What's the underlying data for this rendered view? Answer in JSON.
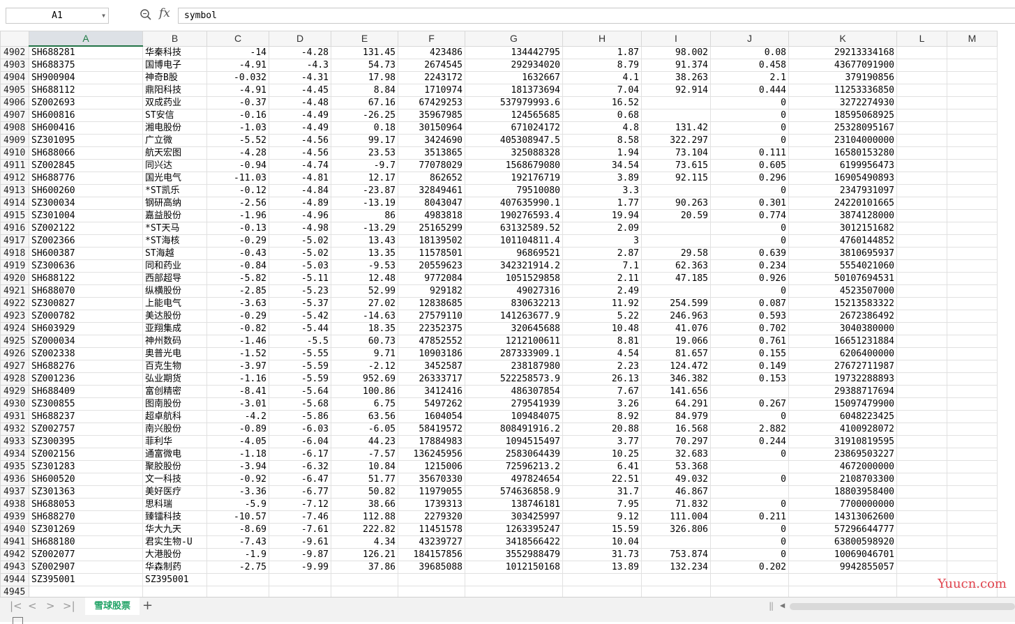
{
  "formula_bar": {
    "cell_ref": "A1",
    "fx_label": "fx",
    "formula_value": "symbol"
  },
  "columns": [
    "A",
    "B",
    "C",
    "D",
    "E",
    "F",
    "G",
    "H",
    "I",
    "J",
    "K",
    "L",
    "M"
  ],
  "active_column": "A",
  "rows": [
    {
      "r": "4902",
      "c": [
        "SH688281",
        "华秦科技",
        "-14",
        "-4.28",
        "131.45",
        "423486",
        "134442795",
        "1.87",
        "98.002",
        "0.08",
        "29213334168"
      ]
    },
    {
      "r": "4903",
      "c": [
        "SH688375",
        "国博电子",
        "-4.91",
        "-4.3",
        "54.73",
        "2674545",
        "292934020",
        "8.79",
        "91.374",
        "0.458",
        "43677091900"
      ]
    },
    {
      "r": "4904",
      "c": [
        "SH900904",
        "神奇B股",
        "-0.032",
        "-4.31",
        "17.98",
        "2243172",
        "1632667",
        "4.1",
        "38.263",
        "2.1",
        "379190856"
      ]
    },
    {
      "r": "4905",
      "c": [
        "SH688112",
        "鼎阳科技",
        "-4.91",
        "-4.45",
        "8.84",
        "1710974",
        "181373694",
        "7.04",
        "92.914",
        "0.444",
        "11253336850"
      ]
    },
    {
      "r": "4906",
      "c": [
        "SZ002693",
        "双成药业",
        "-0.37",
        "-4.48",
        "67.16",
        "67429253",
        "537979993.6",
        "16.52",
        "",
        "0",
        "3272274930"
      ]
    },
    {
      "r": "4907",
      "c": [
        "SH600816",
        "ST安信",
        "-0.16",
        "-4.49",
        "-26.25",
        "35967985",
        "124565685",
        "0.68",
        "",
        "0",
        "18595068925"
      ]
    },
    {
      "r": "4908",
      "c": [
        "SH600416",
        "湘电股份",
        "-1.03",
        "-4.49",
        "0.18",
        "30150964",
        "671024172",
        "4.8",
        "131.42",
        "0",
        "25328095167"
      ]
    },
    {
      "r": "4909",
      "c": [
        "SZ301095",
        "广立微",
        "-5.52",
        "-4.56",
        "99.17",
        "3424690",
        "405308947.5",
        "8.58",
        "322.297",
        "0",
        "23104000000"
      ]
    },
    {
      "r": "4910",
      "c": [
        "SH688066",
        "航天宏图",
        "-4.28",
        "-4.56",
        "23.53",
        "3513865",
        "325088328",
        "1.94",
        "73.104",
        "0.111",
        "16580153280"
      ]
    },
    {
      "r": "4911",
      "c": [
        "SZ002845",
        "同兴达",
        "-0.94",
        "-4.74",
        "-9.7",
        "77078029",
        "1568679080",
        "34.54",
        "73.615",
        "0.605",
        "6199956473"
      ]
    },
    {
      "r": "4912",
      "c": [
        "SH688776",
        "国光电气",
        "-11.03",
        "-4.81",
        "12.17",
        "862652",
        "192176719",
        "3.89",
        "92.115",
        "0.296",
        "16905490893"
      ]
    },
    {
      "r": "4913",
      "c": [
        "SH600260",
        "*ST凯乐",
        "-0.12",
        "-4.84",
        "-23.87",
        "32849461",
        "79510080",
        "3.3",
        "",
        "0",
        "2347931097"
      ]
    },
    {
      "r": "4914",
      "c": [
        "SZ300034",
        "钢研高纳",
        "-2.56",
        "-4.89",
        "-13.19",
        "8043047",
        "407635990.1",
        "1.77",
        "90.263",
        "0.301",
        "24220101665"
      ]
    },
    {
      "r": "4915",
      "c": [
        "SZ301004",
        "嘉益股份",
        "-1.96",
        "-4.96",
        "86",
        "4983818",
        "190276593.4",
        "19.94",
        "20.59",
        "0.774",
        "3874128000"
      ]
    },
    {
      "r": "4916",
      "c": [
        "SZ002122",
        "*ST天马",
        "-0.13",
        "-4.98",
        "-13.29",
        "25165299",
        "63132589.52",
        "2.09",
        "",
        "0",
        "3012151682"
      ]
    },
    {
      "r": "4917",
      "c": [
        "SZ002366",
        "*ST海核",
        "-0.29",
        "-5.02",
        "13.43",
        "18139502",
        "101104811.4",
        "3",
        "",
        "0",
        "4760144852"
      ]
    },
    {
      "r": "4918",
      "c": [
        "SH600387",
        "ST海越",
        "-0.43",
        "-5.02",
        "13.35",
        "11578501",
        "96869521",
        "2.87",
        "29.58",
        "0.639",
        "3810695937"
      ]
    },
    {
      "r": "4919",
      "c": [
        "SZ300636",
        "同和药业",
        "-0.84",
        "-5.03",
        "-9.53",
        "20559623",
        "342321914.2",
        "7.1",
        "62.363",
        "0.234",
        "5554021060"
      ]
    },
    {
      "r": "4920",
      "c": [
        "SH688122",
        "西部超导",
        "-5.82",
        "-5.11",
        "12.48",
        "9772084",
        "1051529858",
        "2.11",
        "47.185",
        "0.926",
        "50107694531"
      ]
    },
    {
      "r": "4921",
      "c": [
        "SH688070",
        "纵横股份",
        "-2.85",
        "-5.23",
        "52.99",
        "929182",
        "49027316",
        "2.49",
        "",
        "0",
        "4523507000"
      ]
    },
    {
      "r": "4922",
      "c": [
        "SZ300827",
        "上能电气",
        "-3.63",
        "-5.37",
        "27.02",
        "12838685",
        "830632213",
        "11.92",
        "254.599",
        "0.087",
        "15213583322"
      ]
    },
    {
      "r": "4923",
      "c": [
        "SZ000782",
        "美达股份",
        "-0.29",
        "-5.42",
        "-14.63",
        "27579110",
        "141263677.9",
        "5.22",
        "246.963",
        "0.593",
        "2672386492"
      ]
    },
    {
      "r": "4924",
      "c": [
        "SH603929",
        "亚翔集成",
        "-0.82",
        "-5.44",
        "18.35",
        "22352375",
        "320645688",
        "10.48",
        "41.076",
        "0.702",
        "3040380000"
      ]
    },
    {
      "r": "4925",
      "c": [
        "SZ000034",
        "神州数码",
        "-1.46",
        "-5.5",
        "60.73",
        "47852552",
        "1212100611",
        "8.81",
        "19.066",
        "0.761",
        "16651231884"
      ]
    },
    {
      "r": "4926",
      "c": [
        "SZ002338",
        "奥普光电",
        "-1.52",
        "-5.55",
        "9.71",
        "10903186",
        "287333909.1",
        "4.54",
        "81.657",
        "0.155",
        "6206400000"
      ]
    },
    {
      "r": "4927",
      "c": [
        "SH688276",
        "百克生物",
        "-3.97",
        "-5.59",
        "-2.12",
        "3452587",
        "238187980",
        "2.23",
        "124.472",
        "0.149",
        "27672711987"
      ]
    },
    {
      "r": "4928",
      "c": [
        "SZ001236",
        "弘业期货",
        "-1.16",
        "-5.59",
        "952.69",
        "26333717",
        "522258573.9",
        "26.13",
        "346.382",
        "0.153",
        "19732288893"
      ]
    },
    {
      "r": "4929",
      "c": [
        "SH688409",
        "富创精密",
        "-8.41",
        "-5.64",
        "100.86",
        "3412416",
        "486307854",
        "7.67",
        "141.656",
        "",
        "29388717694"
      ]
    },
    {
      "r": "4930",
      "c": [
        "SZ300855",
        "图南股份",
        "-3.01",
        "-5.68",
        "6.75",
        "5497262",
        "279541939",
        "3.26",
        "64.291",
        "0.267",
        "15097479900"
      ]
    },
    {
      "r": "4931",
      "c": [
        "SH688237",
        "超卓航科",
        "-4.2",
        "-5.86",
        "63.56",
        "1604054",
        "109484075",
        "8.92",
        "84.979",
        "0",
        "6048223425"
      ]
    },
    {
      "r": "4932",
      "c": [
        "SZ002757",
        "南兴股份",
        "-0.89",
        "-6.03",
        "-6.05",
        "58419572",
        "808491916.2",
        "20.88",
        "16.568",
        "2.882",
        "4100928072"
      ]
    },
    {
      "r": "4933",
      "c": [
        "SZ300395",
        "菲利华",
        "-4.05",
        "-6.04",
        "44.23",
        "17884983",
        "1094515497",
        "3.77",
        "70.297",
        "0.244",
        "31910819595"
      ]
    },
    {
      "r": "4934",
      "c": [
        "SZ002156",
        "通富微电",
        "-1.18",
        "-6.17",
        "-7.57",
        "136245956",
        "2583064439",
        "10.25",
        "32.683",
        "0",
        "23869503227"
      ]
    },
    {
      "r": "4935",
      "c": [
        "SZ301283",
        "聚胶股份",
        "-3.94",
        "-6.32",
        "10.84",
        "1215006",
        "72596213.2",
        "6.41",
        "53.368",
        "",
        "4672000000"
      ]
    },
    {
      "r": "4936",
      "c": [
        "SH600520",
        "文一科技",
        "-0.92",
        "-6.47",
        "51.77",
        "35670330",
        "497824654",
        "22.51",
        "49.032",
        "0",
        "2108703300"
      ]
    },
    {
      "r": "4937",
      "c": [
        "SZ301363",
        "美好医疗",
        "-3.36",
        "-6.77",
        "50.82",
        "11979055",
        "574636858.9",
        "31.7",
        "46.867",
        "",
        "18803958400"
      ]
    },
    {
      "r": "4938",
      "c": [
        "SH688053",
        "思科瑞",
        "-5.9",
        "-7.12",
        "38.66",
        "1739313",
        "138746181",
        "7.95",
        "71.832",
        "0",
        "7700000000"
      ]
    },
    {
      "r": "4939",
      "c": [
        "SH688270",
        "臻镭科技",
        "-10.57",
        "-7.46",
        "112.88",
        "2279320",
        "303425997",
        "9.12",
        "111.004",
        "0.211",
        "14313062600"
      ]
    },
    {
      "r": "4940",
      "c": [
        "SZ301269",
        "华大九天",
        "-8.69",
        "-7.61",
        "222.82",
        "11451578",
        "1263395247",
        "15.59",
        "326.806",
        "0",
        "57296644777"
      ]
    },
    {
      "r": "4941",
      "c": [
        "SH688180",
        "君实生物-U",
        "-7.43",
        "-9.61",
        "4.34",
        "43239727",
        "3418566422",
        "10.04",
        "",
        "0",
        "63800598920"
      ]
    },
    {
      "r": "4942",
      "c": [
        "SZ002077",
        "大港股份",
        "-1.9",
        "-9.87",
        "126.21",
        "184157856",
        "3552988479",
        "31.73",
        "753.874",
        "0",
        "10069046701"
      ]
    },
    {
      "r": "4943",
      "c": [
        "SZ002907",
        "华森制药",
        "-2.75",
        "-9.99",
        "37.86",
        "39685088",
        "1012150168",
        "13.89",
        "132.234",
        "0.202",
        "9942855057"
      ]
    },
    {
      "r": "4944",
      "c": [
        "SZ395001",
        "SZ395001",
        "",
        "",
        "",
        "",
        "",
        "",
        "",
        "",
        ""
      ]
    },
    {
      "r": "4945",
      "c": [
        "",
        "",
        "",
        "",
        "",
        "",
        "",
        "",
        "",
        "",
        ""
      ]
    }
  ],
  "sheet_bar": {
    "nav_first": "|<",
    "nav_prev": "<",
    "nav_next": ">",
    "nav_last": ">|",
    "active_sheet": "雪球股票",
    "add_sheet": "+"
  },
  "watermark": "Yuucn.com"
}
